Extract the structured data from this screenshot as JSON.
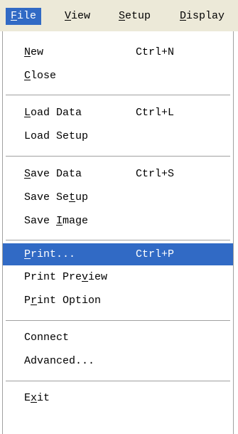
{
  "menubar": {
    "items": [
      {
        "label": "File",
        "mnemonic_prefix": "",
        "mnemonic": "F",
        "mnemonic_suffix": "ile"
      },
      {
        "label": "View",
        "mnemonic_prefix": "",
        "mnemonic": "V",
        "mnemonic_suffix": "iew"
      },
      {
        "label": "Setup",
        "mnemonic_prefix": "",
        "mnemonic": "S",
        "mnemonic_suffix": "etup"
      },
      {
        "label": "Display",
        "mnemonic_prefix": "",
        "mnemonic": "D",
        "mnemonic_suffix": "isplay"
      }
    ]
  },
  "file_menu": {
    "new": {
      "pre": "",
      "mn": "N",
      "post": "ew",
      "shortcut": "Ctrl+N"
    },
    "close": {
      "pre": "",
      "mn": "C",
      "post": "lose"
    },
    "load_data": {
      "pre": "",
      "mn": "L",
      "post": "oad Data",
      "shortcut": "Ctrl+L"
    },
    "load_setup": {
      "label": "Load Setup"
    },
    "save_data": {
      "pre": "",
      "mn": "S",
      "post": "ave Data",
      "shortcut": "Ctrl+S"
    },
    "save_setup": {
      "pre": "Save Se",
      "mn": "t",
      "post": "up"
    },
    "save_image": {
      "pre": "Save ",
      "mn": "I",
      "post": "mage"
    },
    "print": {
      "pre": "",
      "mn": "P",
      "post": "rint...",
      "shortcut": "Ctrl+P"
    },
    "print_preview": {
      "pre": "Print Pre",
      "mn": "v",
      "post": "iew"
    },
    "print_option": {
      "pre": "P",
      "mn": "r",
      "post": "int Option"
    },
    "connect": {
      "label": "Connect"
    },
    "advanced": {
      "label": "Advanced..."
    },
    "exit": {
      "pre": "E",
      "mn": "x",
      "post": "it"
    }
  },
  "colors": {
    "highlight": "#316ac5",
    "menubar_bg": "#ece9d8",
    "separator": "#a0a0a0"
  }
}
